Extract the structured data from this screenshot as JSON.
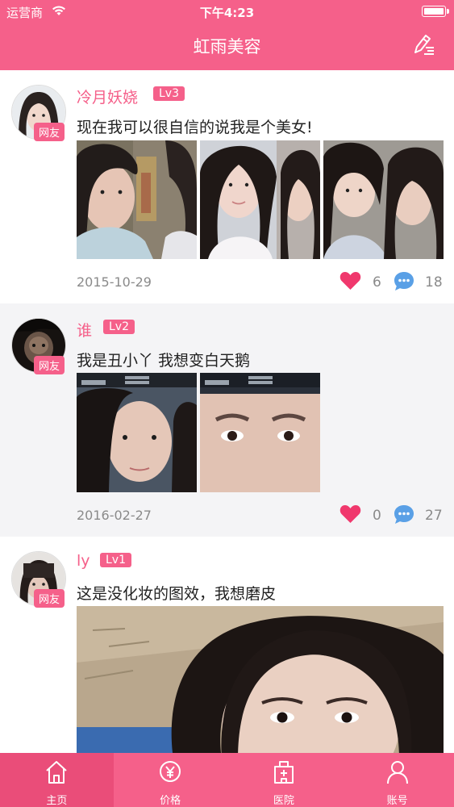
{
  "status_bar": {
    "carrier": "运营商",
    "time": "下午4:23"
  },
  "header": {
    "title": "虹雨美容"
  },
  "posts": [
    {
      "username": "冷月妖娆",
      "level": "Lv3",
      "badge": "网友",
      "text": "现在我可以很自信的说我是个美女!",
      "date": "2015-10-29",
      "likes": "6",
      "comments": "18"
    },
    {
      "username": "谁",
      "level": "Lv2",
      "badge": "网友",
      "text": "我是丑小丫 我想变白天鹅",
      "date": "2016-02-27",
      "likes": "0",
      "comments": "27"
    },
    {
      "username": "ly",
      "level": "Lv1",
      "badge": "网友",
      "text": "这是没化妆的图效，我想磨皮"
    }
  ],
  "tabs": [
    {
      "label": "主页",
      "icon": "home-icon",
      "active": true
    },
    {
      "label": "价格",
      "icon": "price-icon"
    },
    {
      "label": "医院",
      "icon": "hospital-icon"
    },
    {
      "label": "账号",
      "icon": "account-icon"
    }
  ],
  "colors": {
    "accent": "#f5608a",
    "accent_dark": "#ea4d79",
    "like": "#f0386d",
    "comment": "#5aa0e6"
  }
}
